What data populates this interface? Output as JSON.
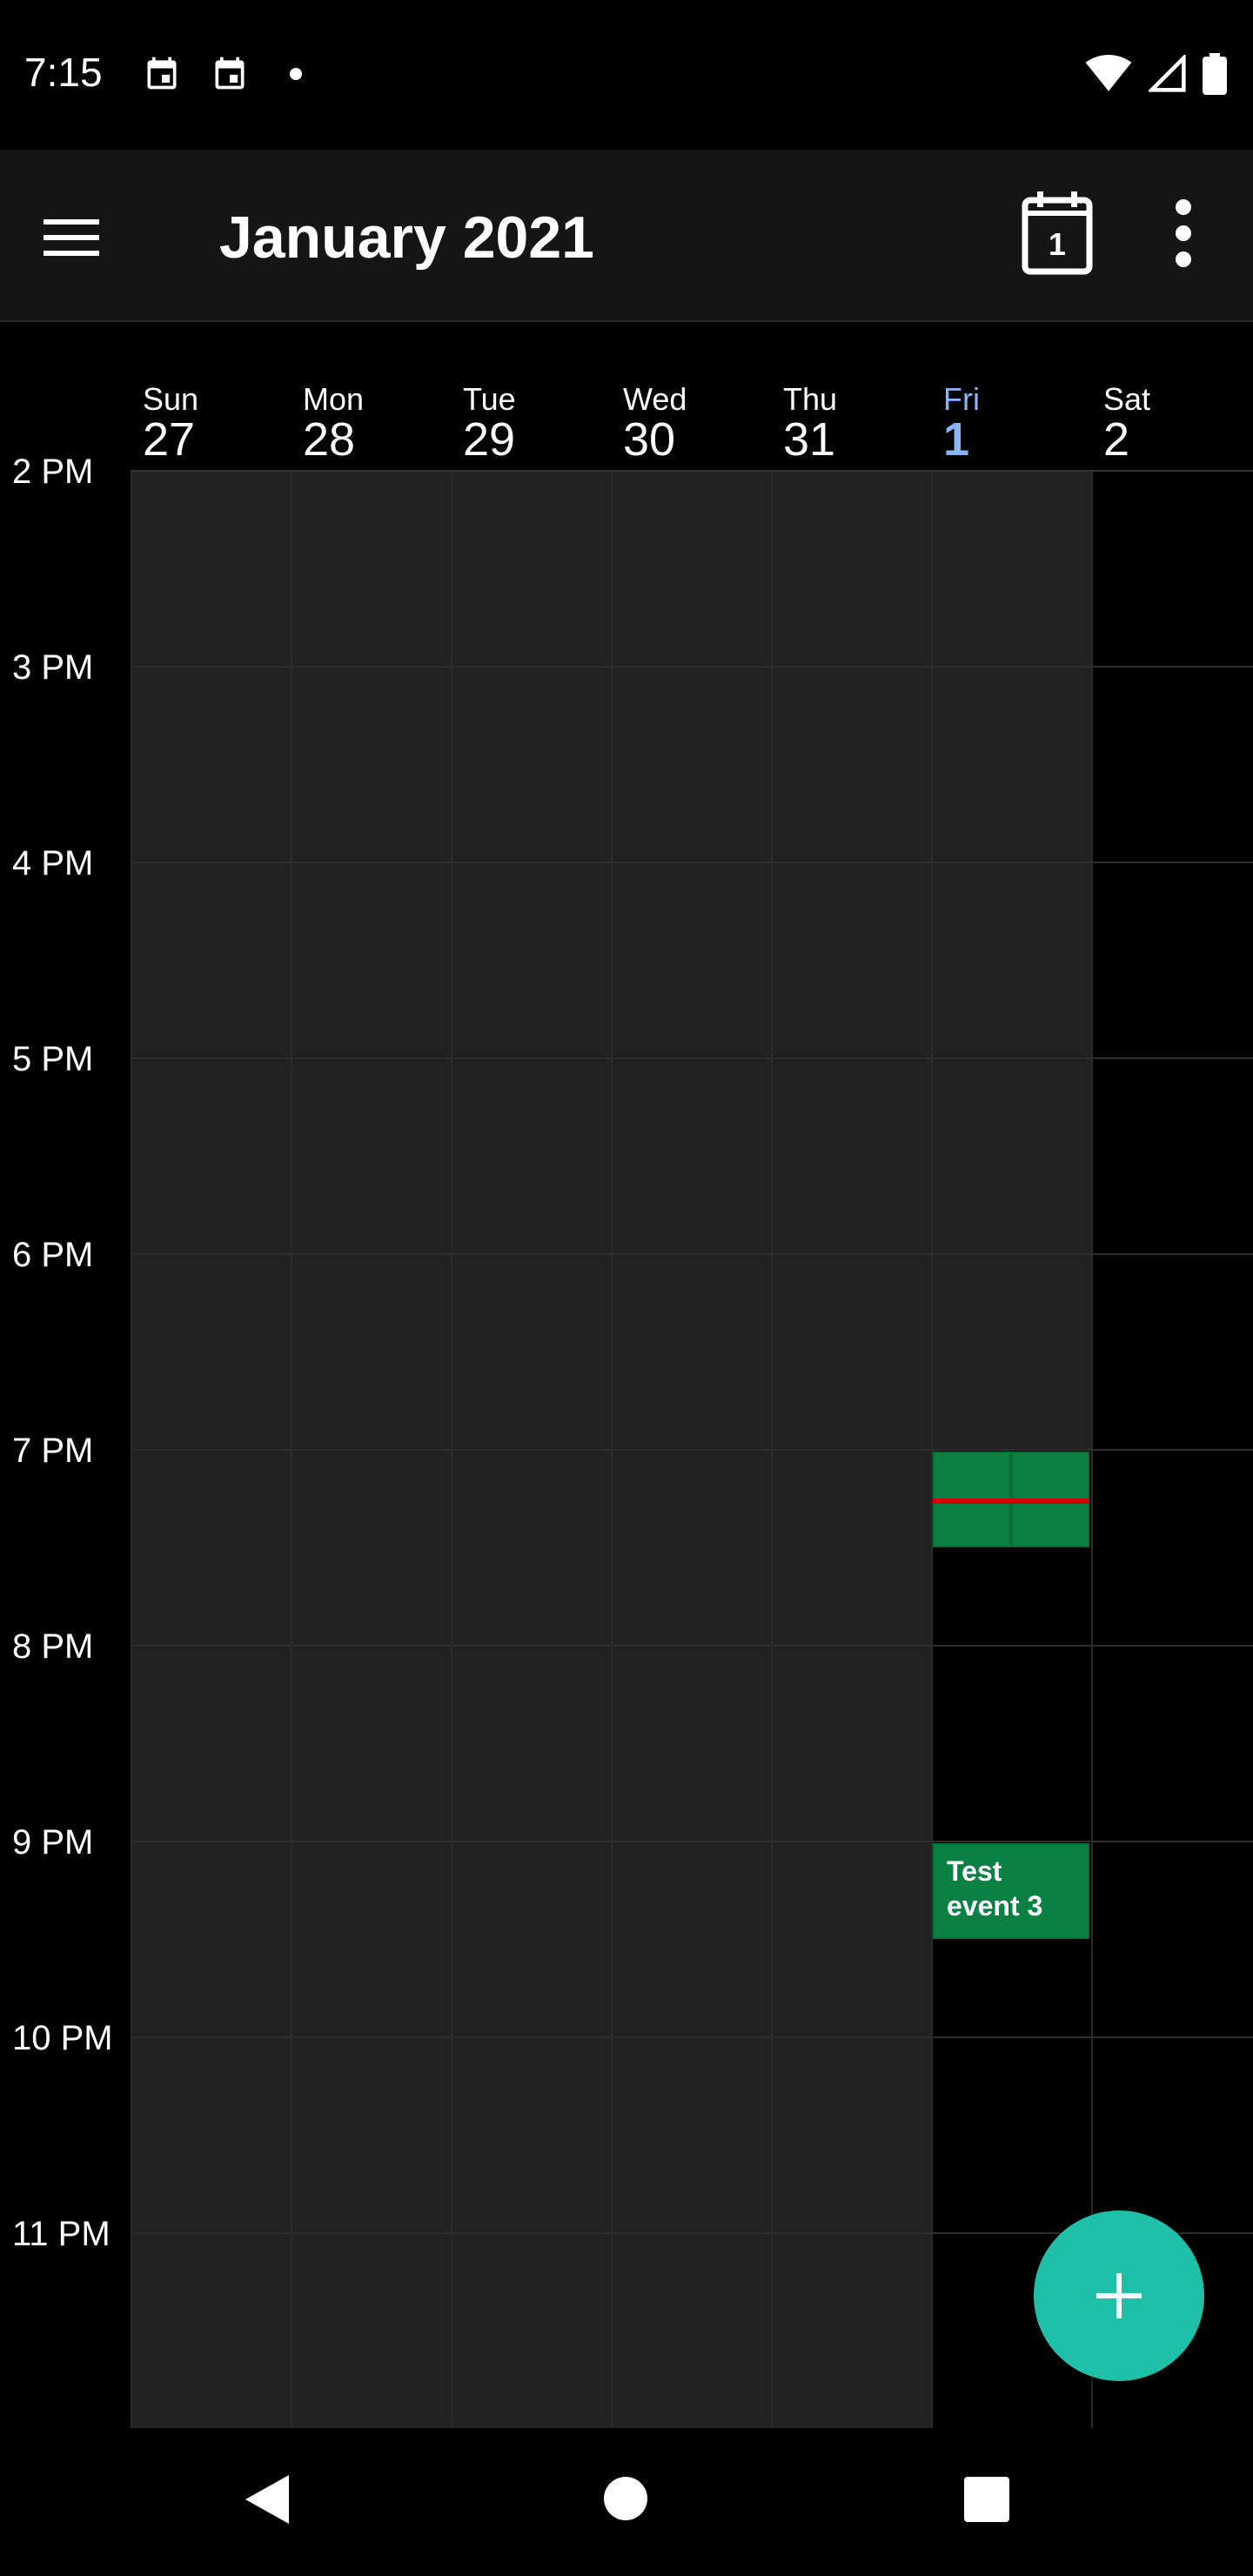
{
  "status_bar": {
    "time": "7:15",
    "left_icons": [
      "calendar-icon",
      "calendar-icon",
      "dot"
    ],
    "right_icons": [
      "wifi-icon",
      "signal-icon",
      "battery-icon"
    ]
  },
  "app_bar": {
    "title": "January 2021",
    "today_button_day": "1",
    "icons": [
      "menu-icon",
      "today-icon",
      "more-vert-icon"
    ]
  },
  "week": {
    "days": [
      {
        "name": "Sun",
        "num": "27"
      },
      {
        "name": "Mon",
        "num": "28"
      },
      {
        "name": "Tue",
        "num": "29"
      },
      {
        "name": "Wed",
        "num": "30"
      },
      {
        "name": "Thu",
        "num": "31"
      },
      {
        "name": "Fri",
        "num": "1",
        "today": true
      },
      {
        "name": "Sat",
        "num": "2"
      }
    ]
  },
  "time_labels": [
    "2 PM",
    "3 PM",
    "4 PM",
    "5 PM",
    "6 PM",
    "7 PM",
    "8 PM",
    "9 PM",
    "10 PM",
    "11 PM"
  ],
  "events": [
    {
      "title": "",
      "day": "Fri",
      "start": "7:00 PM",
      "end": "7:30 PM"
    },
    {
      "title": "",
      "day": "Fri",
      "start": "7:00 PM",
      "end": "7:30 PM"
    },
    {
      "title": "Test event 3",
      "day": "Fri",
      "start": "9:00 PM",
      "end": "9:30 PM"
    }
  ],
  "current_time": "7:15 PM",
  "colors": {
    "event_green": "#0b8043",
    "now_line": "#d50000",
    "today_blue": "#8ab4f8",
    "fab": "#1fbfa8",
    "past_background": "#212121"
  },
  "fab": {
    "icon": "plus-icon"
  },
  "nav_bar": {
    "icons": [
      "back-icon",
      "home-icon",
      "recents-icon"
    ]
  }
}
